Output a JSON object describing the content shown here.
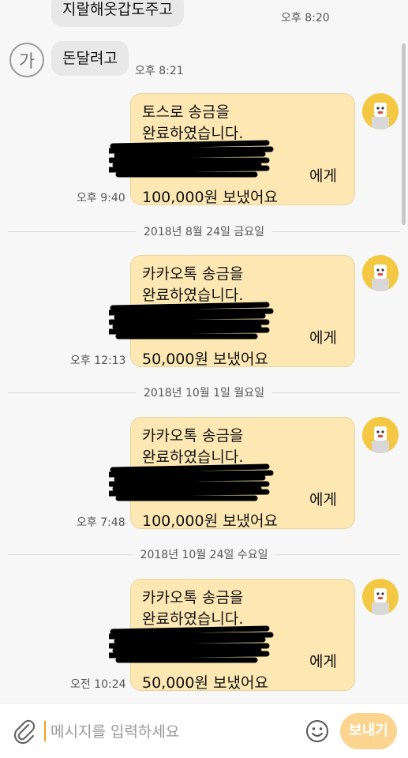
{
  "messages_received": [
    {
      "text": "지랄해옷갑도주고",
      "time": "오후 8:20"
    },
    {
      "text": "돈달려고",
      "time": "오후 8:21"
    }
  ],
  "received_avatar_label": "가",
  "transfers": [
    {
      "line1": "토스로 송금을",
      "line2": "완료하였습니다.",
      "recipient_suffix": "에게",
      "amount": "100,000원 보냈어요",
      "time": "오후 9:40"
    },
    {
      "line1": "카카오톡 송금을",
      "line2": "완료하였습니다.",
      "recipient_suffix": "에게",
      "amount": "50,000원 보냈어요",
      "time": "오후 12:13"
    },
    {
      "line1": "카카오톡 송금을",
      "line2": "완료하였습니다.",
      "recipient_suffix": "에게",
      "amount": "100,000원 보냈어요",
      "time": "오후 7:48"
    },
    {
      "line1": "카카오톡 송금을",
      "line2": "완료하였습니다.",
      "recipient_suffix": "에게",
      "amount": "50,000원 보냈어요",
      "time": "오전 10:24"
    }
  ],
  "date_dividers": [
    "2018년 8월 24일 금요일",
    "2018년 10월 1일 월요일",
    "2018년 10월 24일 수요일"
  ],
  "input": {
    "placeholder": "메시지를 입력하세요",
    "value": ""
  },
  "send_button_label": "보내기",
  "colors": {
    "sent_bubble": "#fde8b4",
    "received_bubble": "#e8e8e8",
    "send_button": "#fbd58f",
    "bot_avatar": "#f4c842"
  }
}
